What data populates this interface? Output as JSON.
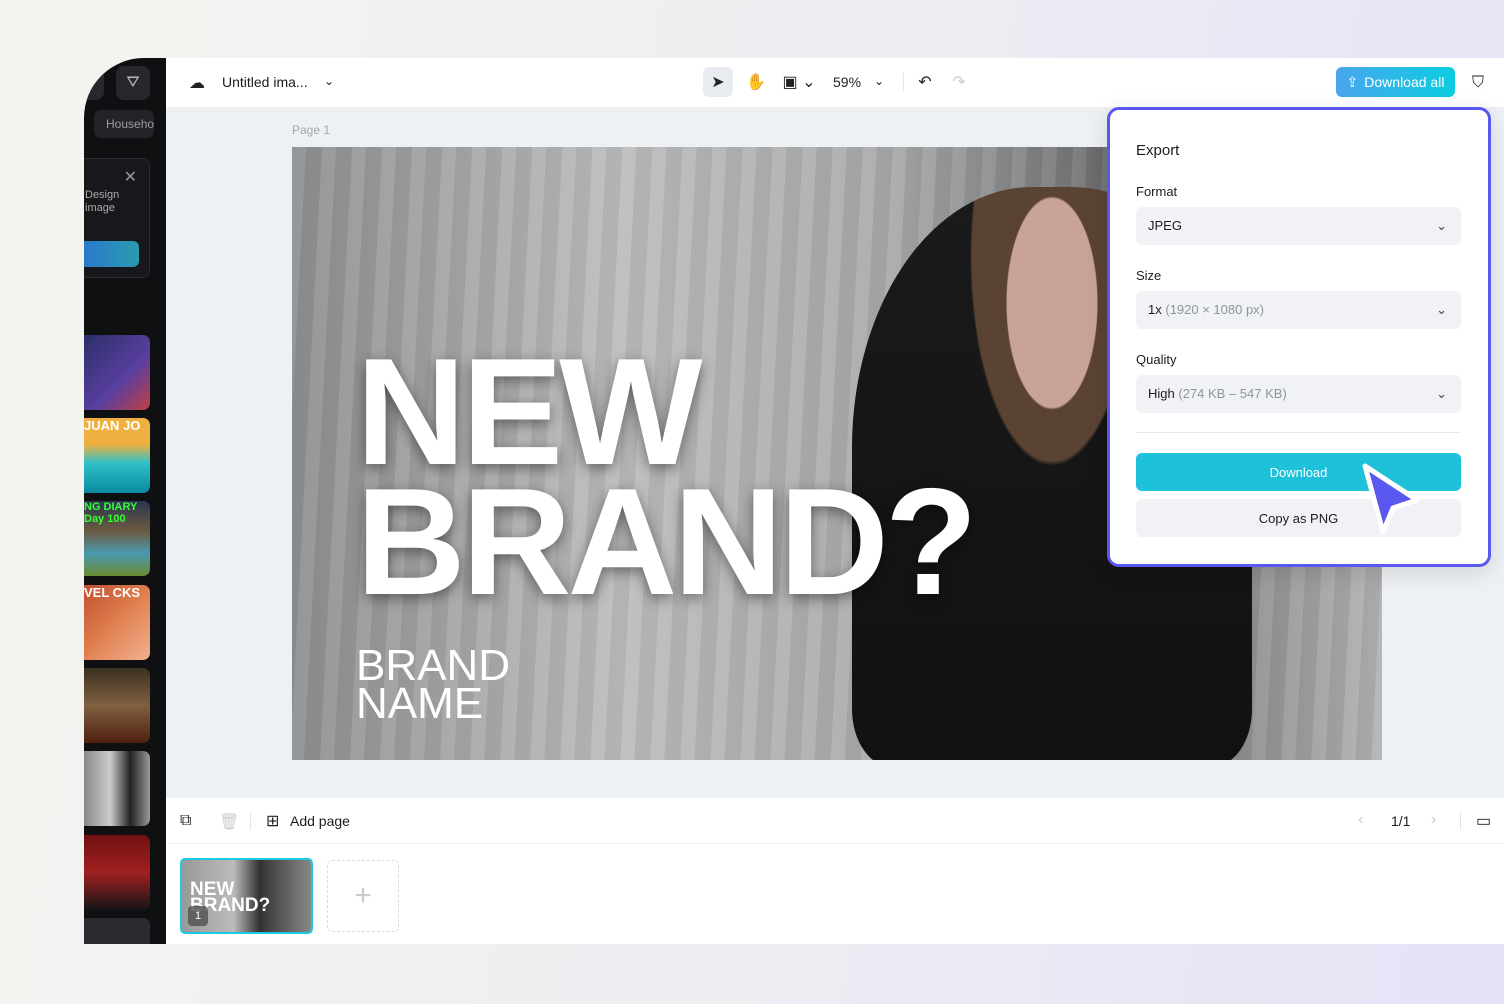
{
  "sidebar": {
    "chip": "Household",
    "promo_text": "Design\nimage",
    "thumbs": [
      "",
      "JUAN JO",
      "NG DIARY Day 100",
      "VEL CKS",
      "",
      "",
      "",
      ""
    ]
  },
  "topbar": {
    "title": "Untitled ima...",
    "zoom": "59%",
    "download_all": "Download all"
  },
  "canvas": {
    "page_label": "Page 1",
    "headline_1": "NEW",
    "headline_2": "BRAND?",
    "brand_1": "BRAND",
    "brand_2": "NAME"
  },
  "bottombar": {
    "add_page": "Add page",
    "page_counter": "1/1"
  },
  "thumbnails": [
    {
      "text": "NEW BRAND?",
      "number": "1"
    }
  ],
  "export": {
    "title": "Export",
    "format_label": "Format",
    "format_value": "JPEG",
    "size_label": "Size",
    "size_value": "1x",
    "size_detail": "(1920 × 1080 px)",
    "quality_label": "Quality",
    "quality_value": "High",
    "quality_detail": "(274 KB – 547 KB)",
    "download": "Download",
    "copy_png": "Copy as PNG"
  },
  "colors": {
    "accent": "#1fc0da",
    "panel_border": "#5a58f0",
    "cursor": "#5a58f0"
  }
}
